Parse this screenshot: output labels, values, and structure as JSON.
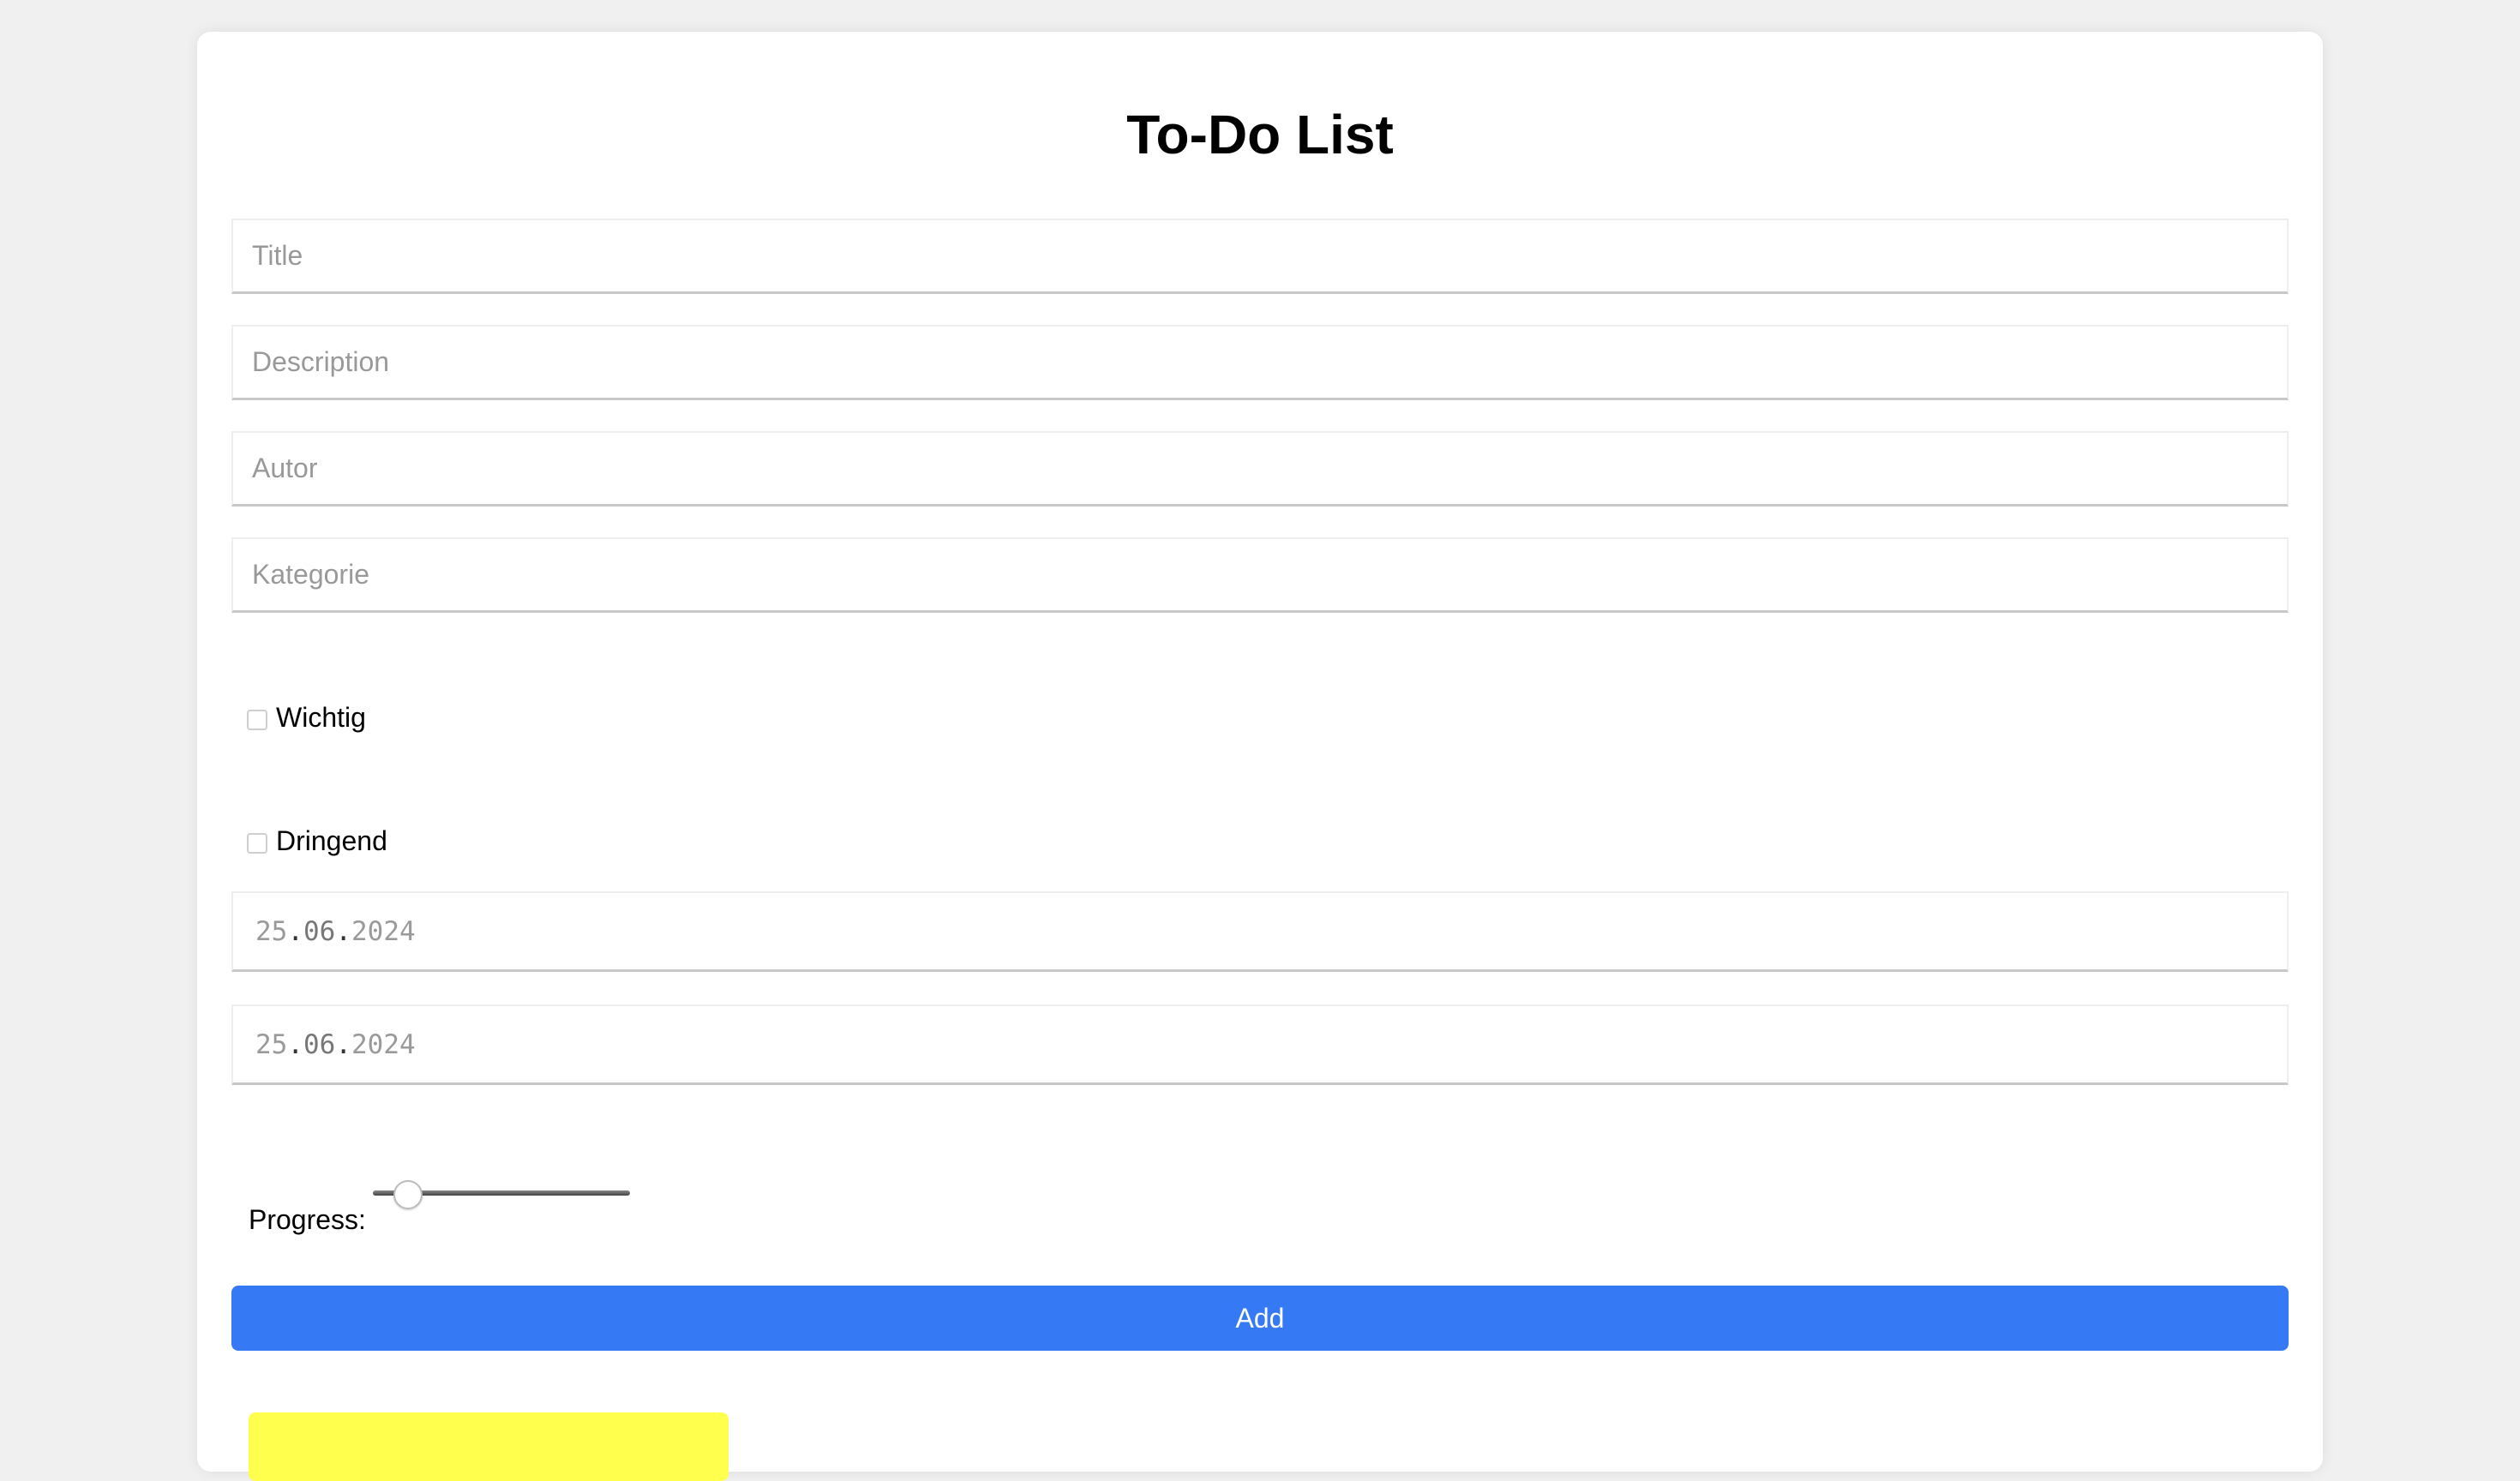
{
  "app": {
    "title": "To-Do List"
  },
  "form": {
    "title_placeholder": "Title",
    "description_placeholder": "Description",
    "author_placeholder": "Autor",
    "category_placeholder": "Kategorie",
    "important_label": "Wichtig",
    "important_checked": false,
    "urgent_label": "Dringend",
    "urgent_checked": false,
    "start_date": {
      "day": "25",
      "month": "06",
      "year": "2024"
    },
    "end_date": {
      "day": "25",
      "month": "06",
      "year": "2024"
    },
    "date_separator": ".",
    "progress_label": "Progress:",
    "progress_value": 0,
    "add_button_label": "Add"
  },
  "colors": {
    "accent": "#3679f5",
    "note": "#ffff4d",
    "background": "#f0f0f0"
  }
}
